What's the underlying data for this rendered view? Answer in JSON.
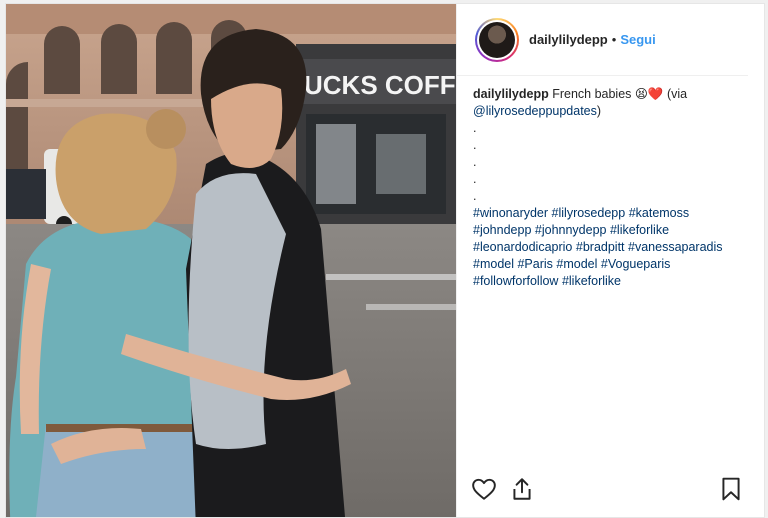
{
  "post": {
    "username": "dailylilydepp",
    "separator": "•",
    "follow_label": "Segui",
    "caption": {
      "user": "dailylilydepp",
      "text": " French babies 😫❤️ (via ",
      "mention": "@lilyrosedeppupdates",
      "close": ")",
      "dots": [
        ".",
        ".",
        ".",
        ".",
        "."
      ],
      "hashtags": [
        [
          "#winonaryder",
          "#lilyrosedepp",
          "#katemoss"
        ],
        [
          "#johndepp",
          "#johnnydepp",
          "#likeforlike"
        ],
        [
          "#leonardodicaprio",
          "#bradpitt",
          "#vanessaparadis"
        ],
        [
          "#model",
          "#Paris",
          "#model",
          "#Vogueparis"
        ],
        [
          "#followforfollow",
          "#likeforlike"
        ]
      ]
    },
    "photo_sign_text": "UCKS COFFE"
  },
  "icons": {
    "like": "heart-icon",
    "share": "share-icon",
    "save": "bookmark-icon"
  },
  "colors": {
    "link": "#003569",
    "follow": "#3897f0",
    "text": "#262626",
    "border": "#efefef"
  }
}
